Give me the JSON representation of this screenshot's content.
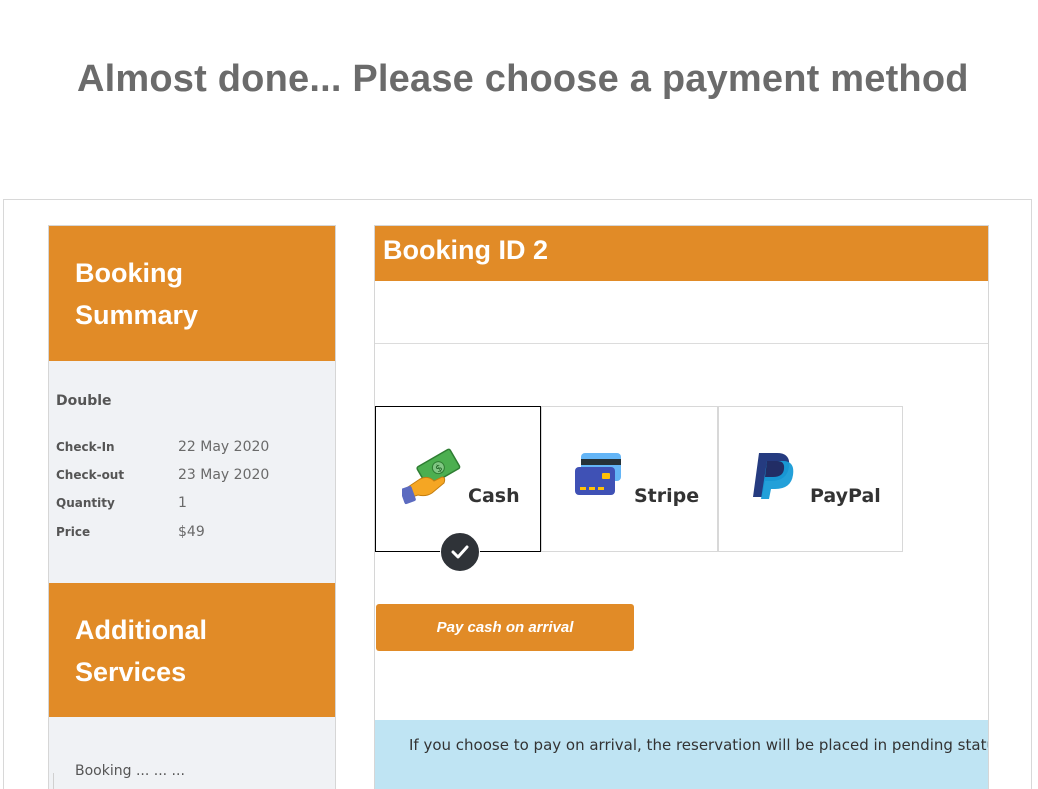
{
  "page": {
    "title": "Almost done... Please choose a payment method"
  },
  "sidebar": {
    "summary_heading_line1": "Booking",
    "summary_heading_line2": "Summary",
    "room": "Double",
    "details": [
      {
        "label": "Check-In",
        "value": "22 May 2020"
      },
      {
        "label": "Check-out",
        "value": "23 May 2020"
      },
      {
        "label": "Quantity",
        "value": "1"
      },
      {
        "label": "Price",
        "value": "$49"
      }
    ],
    "services_heading_line1": "Additional",
    "services_heading_line2": "Services",
    "services_partial_text": "Booking ... ... ..."
  },
  "main": {
    "booking_id_heading": "Booking ID 2",
    "payment_methods": [
      {
        "label": "Cash",
        "icon": "cash-hand-icon",
        "selected": true
      },
      {
        "label": "Stripe",
        "icon": "credit-card-icon",
        "selected": false
      },
      {
        "label": "PayPal",
        "icon": "paypal-icon",
        "selected": false
      }
    ],
    "pay_button_label": "Pay cash on arrival",
    "info_text": "If you choose to pay on arrival, the reservation will be placed in pending status"
  },
  "colors": {
    "accent": "#e18b27",
    "sidebar_bg": "#f0f2f5",
    "info_bg": "#bfe4f3",
    "title_gray": "#6b6b6b"
  }
}
